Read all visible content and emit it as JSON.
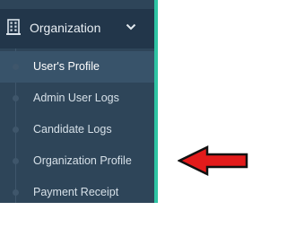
{
  "sidebar": {
    "section": {
      "label": "Organization",
      "icon": "building-icon",
      "expand_icon": "chevron-down-icon"
    },
    "items": [
      {
        "label": "User's Profile",
        "active": true
      },
      {
        "label": "Admin User Logs",
        "active": false
      },
      {
        "label": "Candidate Logs",
        "active": false
      },
      {
        "label": "Organization Profile",
        "active": false
      },
      {
        "label": "Payment Receipt",
        "active": false
      }
    ]
  },
  "annotation": {
    "icon": "red-arrow-icon",
    "points_to": "Organization Profile"
  },
  "colors": {
    "sidebar_bg": "#2e4559",
    "header_bg": "#22364a",
    "accent": "#2ec4a3",
    "arrow": "#e31b1b"
  }
}
